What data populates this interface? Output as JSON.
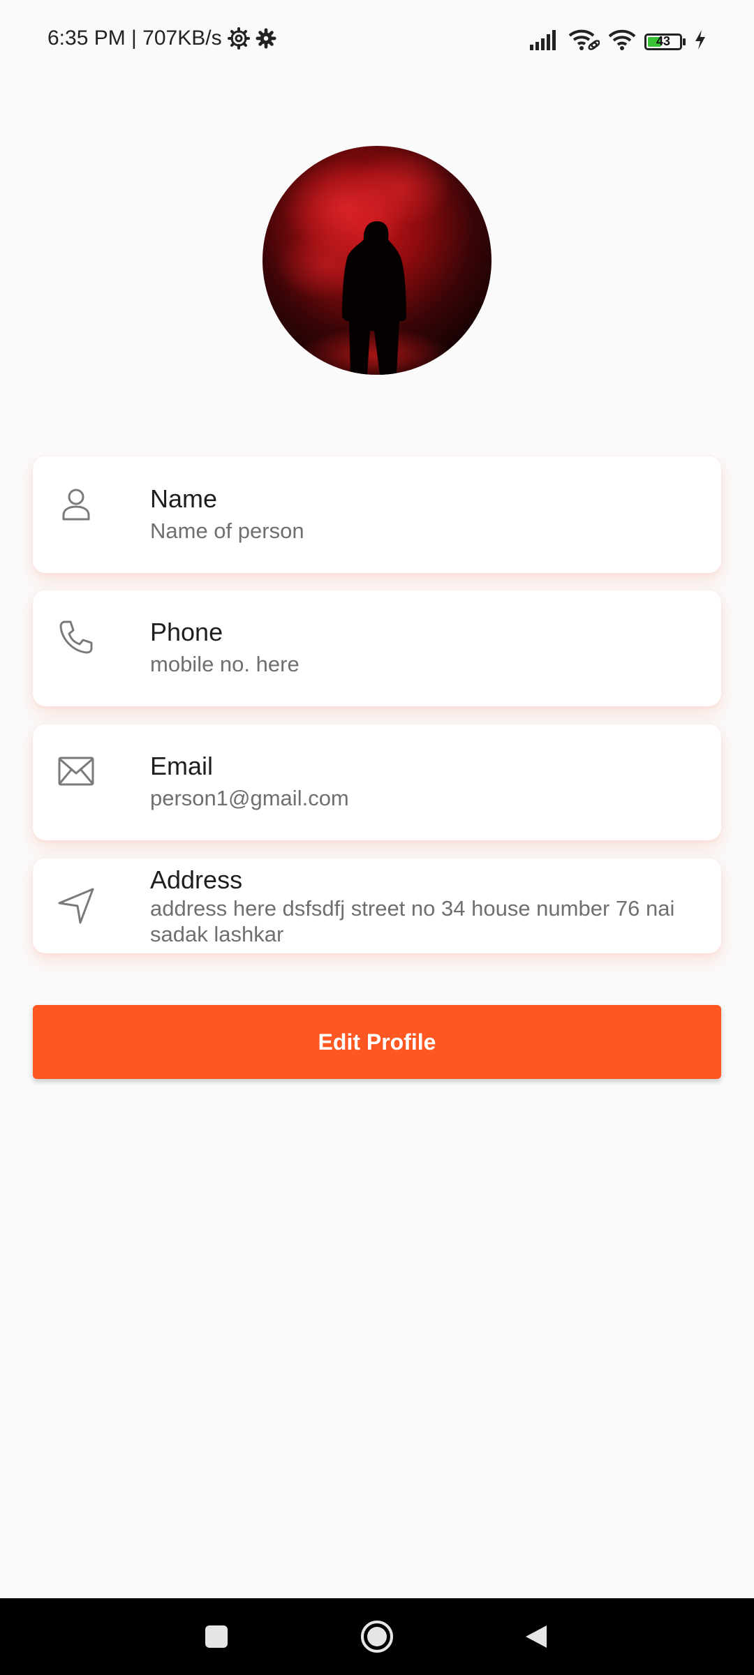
{
  "status_bar": {
    "time_net": "6:35 PM | 707KB/s",
    "battery_level": "43",
    "battery_fraction": 0.43,
    "icons": [
      "gear-outline-icon",
      "gear-icon",
      "signal-icon",
      "wifi-link-icon",
      "wifi-icon",
      "battery-icon",
      "charging-icon"
    ]
  },
  "profile": {
    "avatar": "hooded-figure-red-smoke-photo"
  },
  "fields": [
    {
      "icon": "person-icon",
      "title": "Name",
      "value": "Name of person"
    },
    {
      "icon": "phone-icon",
      "title": "Phone",
      "value": "mobile no. here"
    },
    {
      "icon": "envelope-icon",
      "title": "Email",
      "value": "person1@gmail.com"
    },
    {
      "icon": "navigation-arrow-icon",
      "title": "Address",
      "value": "address here dsfsdfj street no 34 house number 76 nai sadak lashkar"
    }
  ],
  "actions": {
    "edit_label": "Edit Profile"
  },
  "colors": {
    "accent": "#ff5722",
    "background": "#fafafa",
    "card": "#ffffff",
    "title_text": "#1e1e1e",
    "value_text": "#6f6f6f",
    "icon_stroke": "#7a7a7a"
  },
  "nav": {
    "items": [
      "recents-square-icon",
      "home-circle-icon",
      "back-triangle-icon"
    ]
  }
}
